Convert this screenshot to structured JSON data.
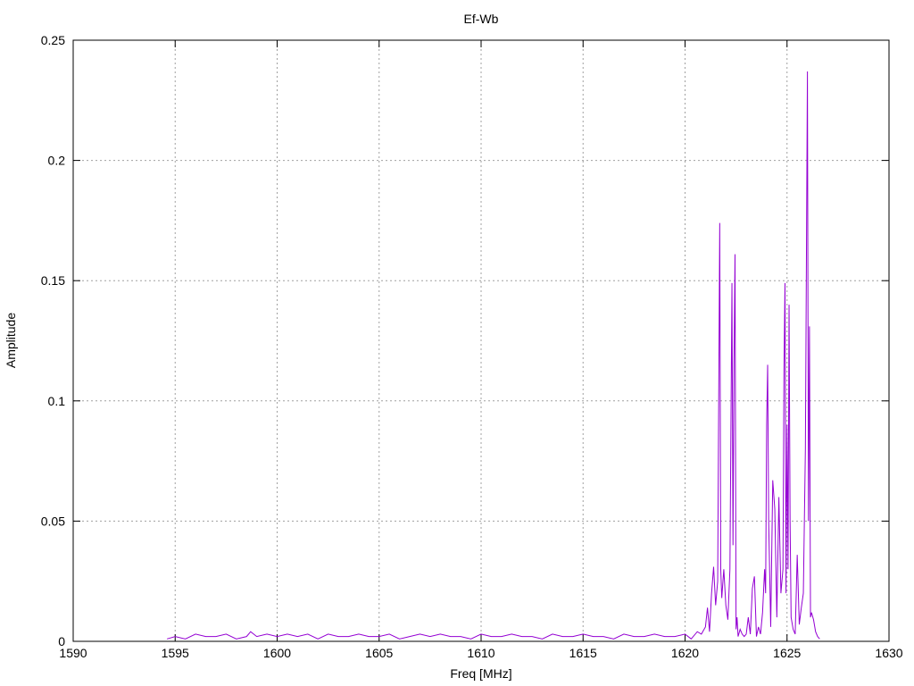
{
  "chart_data": {
    "type": "line",
    "title": "Ef-Wb",
    "xlabel": "Freq [MHz]",
    "ylabel": "Amplitude",
    "xlim": [
      1590,
      1630
    ],
    "ylim": [
      0,
      0.25
    ],
    "x_ticks": [
      1590,
      1595,
      1600,
      1605,
      1610,
      1615,
      1620,
      1625,
      1630
    ],
    "x_tick_labels": [
      "1590",
      "1595",
      "1600",
      "1605",
      "1610",
      "1615",
      "1620",
      "1625",
      "1630"
    ],
    "y_ticks": [
      0,
      0.05,
      0.1,
      0.15,
      0.2,
      0.25
    ],
    "y_tick_labels": [
      "0",
      "0.05",
      "0.1",
      "0.15",
      "0.2",
      "0.25"
    ],
    "grid": true,
    "series_color": "#9400d3",
    "series": [
      {
        "x": [
          1594.6,
          1595.0,
          1595.5,
          1596.0,
          1596.5,
          1597.0,
          1597.5,
          1598.0,
          1598.5,
          1598.7,
          1599.0,
          1599.5,
          1600.0,
          1600.5,
          1601.0,
          1601.5,
          1602.0,
          1602.5,
          1603.0,
          1603.5,
          1604.0,
          1604.5,
          1605.0,
          1605.5,
          1606.0,
          1606.5,
          1607.0,
          1607.5,
          1608.0,
          1608.5,
          1609.0,
          1609.5,
          1610.0,
          1610.5,
          1611.0,
          1611.5,
          1612.0,
          1612.5,
          1613.0,
          1613.5,
          1614.0,
          1614.5,
          1615.0,
          1615.5,
          1616.0,
          1616.5,
          1617.0,
          1617.5,
          1618.0,
          1618.5,
          1619.0,
          1619.5,
          1620.0,
          1620.3,
          1620.6,
          1620.8,
          1621.0,
          1621.1,
          1621.2,
          1621.3,
          1621.4,
          1621.5,
          1621.6,
          1621.65,
          1621.7,
          1621.75,
          1621.8,
          1621.9,
          1622.0,
          1622.1,
          1622.2,
          1622.3,
          1622.35,
          1622.4,
          1622.45,
          1622.5,
          1622.55,
          1622.6,
          1622.7,
          1622.8,
          1622.9,
          1623.0,
          1623.1,
          1623.2,
          1623.3,
          1623.4,
          1623.5,
          1623.6,
          1623.7,
          1623.8,
          1623.9,
          1623.95,
          1624.0,
          1624.05,
          1624.1,
          1624.2,
          1624.3,
          1624.4,
          1624.5,
          1624.6,
          1624.7,
          1624.8,
          1624.85,
          1624.9,
          1624.95,
          1625.0,
          1625.05,
          1625.1,
          1625.15,
          1625.2,
          1625.3,
          1625.4,
          1625.5,
          1625.6,
          1625.7,
          1625.8,
          1625.9,
          1626.0,
          1626.05,
          1626.1,
          1626.15,
          1626.2,
          1626.3,
          1626.4,
          1626.5,
          1626.6
        ],
        "y": [
          0.001,
          0.002,
          0.001,
          0.003,
          0.002,
          0.002,
          0.003,
          0.001,
          0.002,
          0.004,
          0.002,
          0.003,
          0.002,
          0.003,
          0.002,
          0.003,
          0.001,
          0.003,
          0.002,
          0.002,
          0.003,
          0.002,
          0.002,
          0.003,
          0.001,
          0.002,
          0.003,
          0.002,
          0.003,
          0.002,
          0.002,
          0.001,
          0.003,
          0.002,
          0.002,
          0.003,
          0.002,
          0.002,
          0.001,
          0.003,
          0.002,
          0.002,
          0.003,
          0.002,
          0.002,
          0.001,
          0.003,
          0.002,
          0.002,
          0.003,
          0.002,
          0.002,
          0.003,
          0.001,
          0.004,
          0.003,
          0.006,
          0.014,
          0.004,
          0.02,
          0.031,
          0.015,
          0.025,
          0.1,
          0.174,
          0.03,
          0.018,
          0.03,
          0.015,
          0.009,
          0.03,
          0.149,
          0.04,
          0.116,
          0.161,
          0.005,
          0.01,
          0.002,
          0.005,
          0.003,
          0.002,
          0.003,
          0.01,
          0.003,
          0.022,
          0.027,
          0.002,
          0.006,
          0.003,
          0.012,
          0.03,
          0.02,
          0.09,
          0.115,
          0.05,
          0.006,
          0.067,
          0.055,
          0.01,
          0.06,
          0.02,
          0.03,
          0.113,
          0.149,
          0.02,
          0.09,
          0.03,
          0.14,
          0.05,
          0.01,
          0.005,
          0.003,
          0.036,
          0.007,
          0.014,
          0.02,
          0.08,
          0.237,
          0.05,
          0.131,
          0.01,
          0.012,
          0.009,
          0.004,
          0.002,
          0.001
        ]
      }
    ]
  }
}
